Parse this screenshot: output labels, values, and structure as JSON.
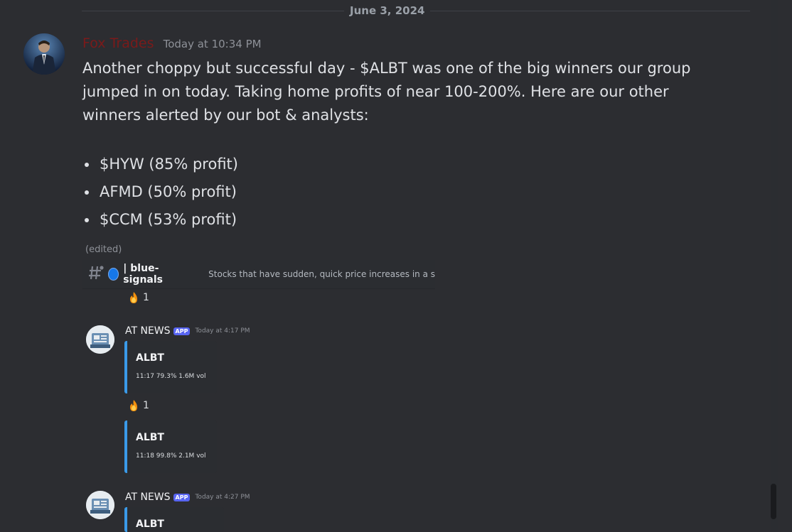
{
  "date_divider": "June 3, 2024",
  "main_message": {
    "author": "Fox Trades",
    "timestamp": "Today at 10:34 PM",
    "paragraph": "Another choppy but successful day - $ALBT was one of the big winners our group jumped in on today. Taking home profits of near 100-200%. Here are our other winners alerted by our bot & analysts:",
    "bullets": [
      "$HYW (85% profit)",
      "AFMD (50% profit)",
      "$CCM (53% profit)"
    ],
    "edited": "(edited)"
  },
  "embedded_screenshot": {
    "channel_name": "| blue-signals",
    "channel_topic": "Stocks that have sudden, quick price increases in a s",
    "reaction_1": {
      "icon": "fire-icon",
      "count": "1"
    },
    "news_1": {
      "author": "AT NEWS",
      "badge": "APP",
      "timestamp": "Today at 4:17 PM",
      "embeds": [
        {
          "title": "ALBT",
          "line": "11:17  79.3%  1.6M vol"
        },
        {
          "title": "ALBT",
          "line": "11:18  99.8%  2.1M vol"
        }
      ],
      "reaction": {
        "icon": "fire-icon",
        "count": "1"
      }
    },
    "news_2": {
      "author": "AT NEWS",
      "badge": "APP",
      "timestamp": "Today at 4:27 PM",
      "partial_title": "ALBT"
    }
  },
  "colors": {
    "background": "#2c2d31",
    "username": "#7a1a1a",
    "embed_accent": "#3a9ae8",
    "app_badge": "#5865f2",
    "blue_dot": "#1677e8"
  }
}
